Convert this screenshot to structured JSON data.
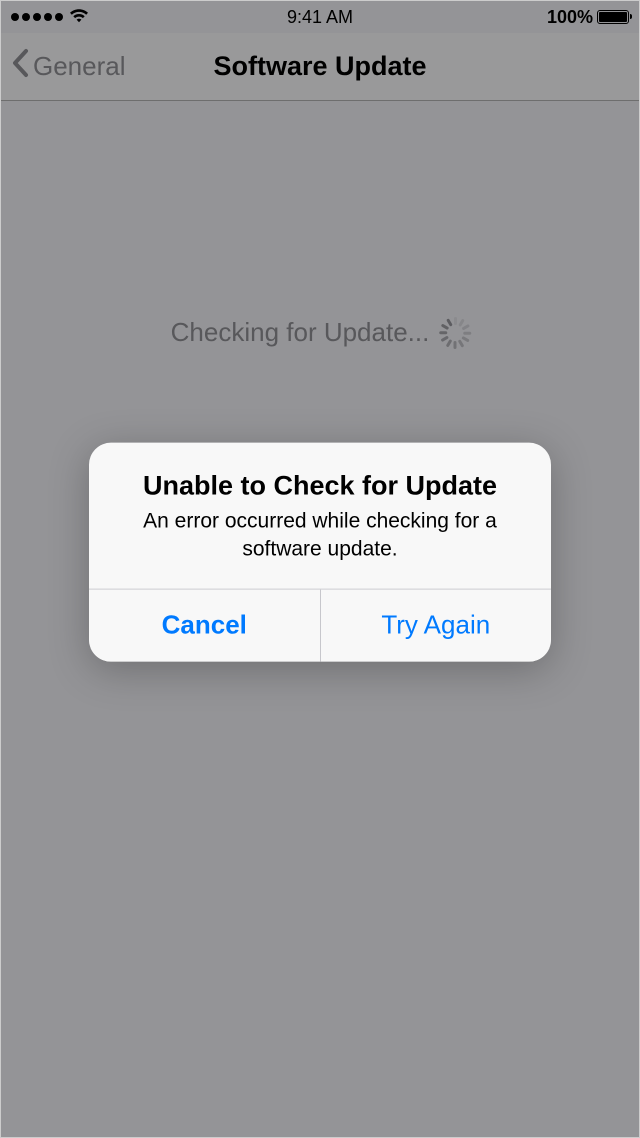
{
  "status_bar": {
    "time": "9:41 AM",
    "battery_percent": "100%"
  },
  "nav": {
    "back_label": "General",
    "title": "Software Update"
  },
  "content": {
    "checking_label": "Checking for Update..."
  },
  "alert": {
    "title": "Unable to Check for Update",
    "message": "An error occurred while checking for a software update.",
    "cancel_label": "Cancel",
    "try_again_label": "Try Again"
  }
}
